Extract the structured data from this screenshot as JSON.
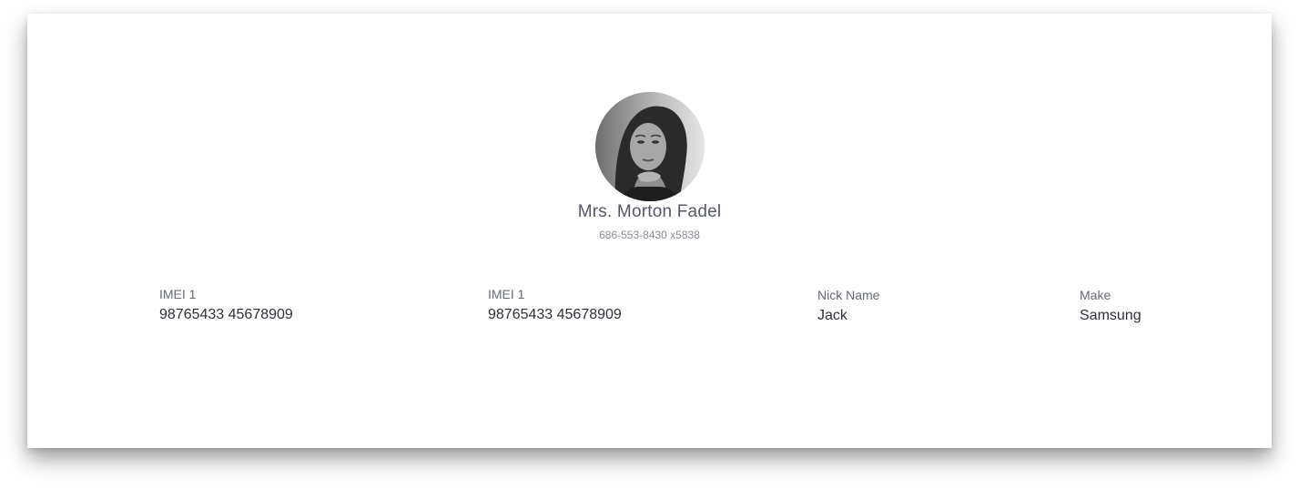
{
  "profile": {
    "name": "Mrs. Morton Fadel",
    "phone": "686-553-8430 x5838",
    "avatar": "profile-photo"
  },
  "details": [
    {
      "label": "IMEI 1",
      "value": "98765433 45678909"
    },
    {
      "label": "IMEI 1",
      "value": "98765433 45678909"
    },
    {
      "label": "Nick Name",
      "value": "Jack"
    },
    {
      "label": "Make",
      "value": "Samsung"
    }
  ]
}
